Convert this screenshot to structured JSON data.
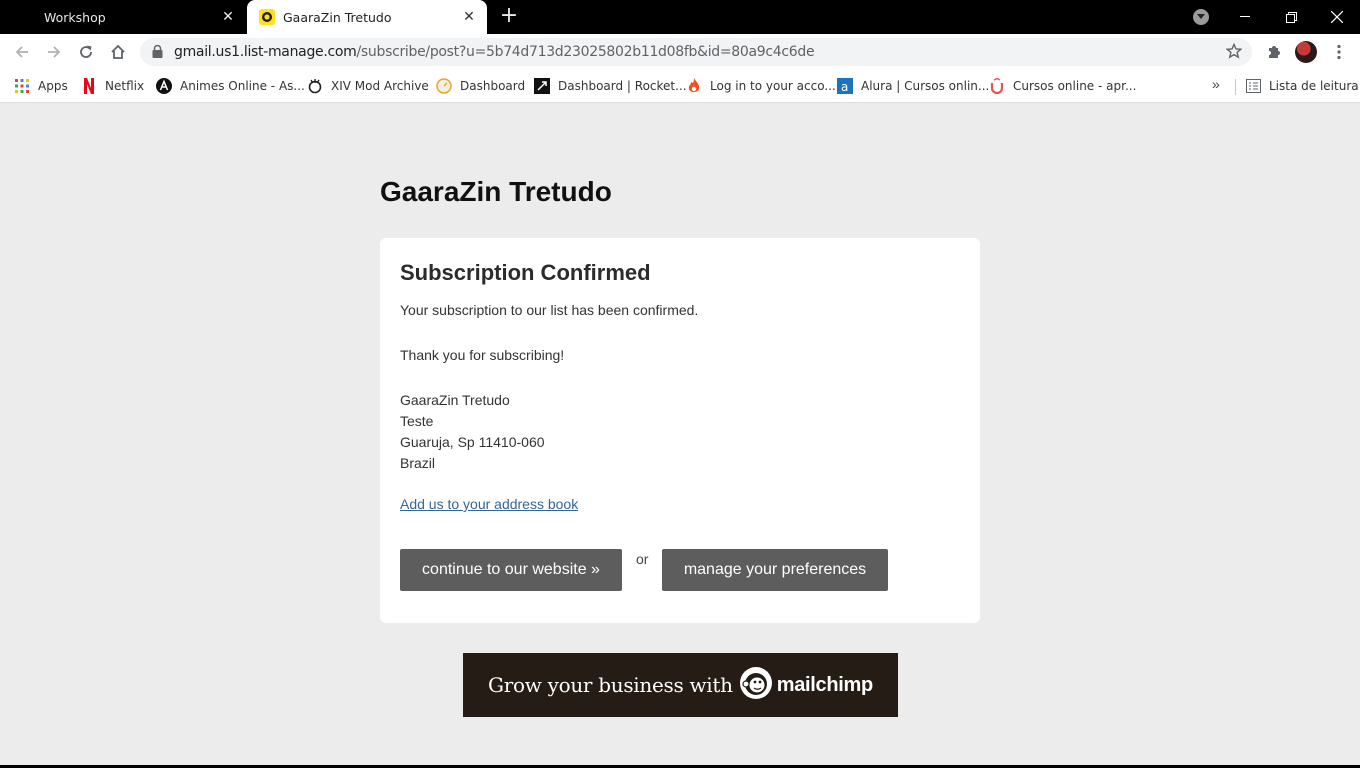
{
  "tabs": [
    {
      "title": "Workshop",
      "active": false
    },
    {
      "title": "GaaraZin Tretudo",
      "active": true
    }
  ],
  "address_bar": {
    "host": "gmail.us1.list-manage.com",
    "path": "/subscribe/post?u=5b74d713d23025802b11d08fb&id=80a9c4c6de"
  },
  "bookmarks": [
    {
      "label": "Apps",
      "icon": "apps-grid-icon"
    },
    {
      "label": "Netflix",
      "icon": "netflix-icon"
    },
    {
      "label": "Animes Online - As...",
      "icon": "animes-online-icon"
    },
    {
      "label": "XIV Mod Archive",
      "icon": "xiv-mod-archive-icon"
    },
    {
      "label": "Dashboard",
      "icon": "dashboard-icon"
    },
    {
      "label": "Dashboard | Rocket...",
      "icon": "rocketseat-icon"
    },
    {
      "label": "Log in to your acco...",
      "icon": "flame-icon"
    },
    {
      "label": "Alura | Cursos onlin...",
      "icon": "alura-icon"
    },
    {
      "label": "Cursos online - apr...",
      "icon": "udemy-icon"
    }
  ],
  "reading_list": "Lista de leitura",
  "page": {
    "brand": "GaaraZin Tretudo",
    "card_title": "Subscription Confirmed",
    "confirmation_text": "Your subscription to our list has been confirmed.",
    "thanks_text": "Thank you for subscribing!",
    "address": [
      "GaaraZin Tretudo",
      "Teste",
      "Guaruja, Sp 11410-060",
      "Brazil"
    ],
    "address_book_link": "Add us to your address book",
    "continue_button": "continue to our website »",
    "or_text": "or",
    "manage_button": "manage your preferences"
  },
  "banner": {
    "text": "Grow your business with",
    "brand": "mailchimp"
  },
  "colors": {
    "tab_strip": "#000000",
    "page_bg": "#ececec",
    "button_bg": "#5d5d5d",
    "link": "#336699",
    "banner_bg": "#241c15"
  }
}
